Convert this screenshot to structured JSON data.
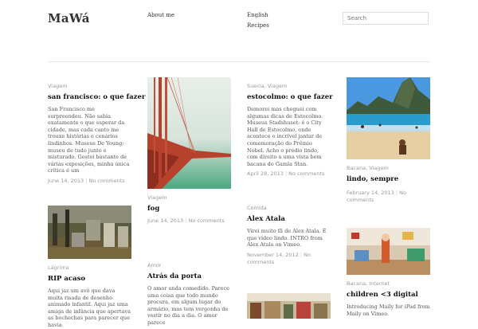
{
  "site": {
    "title": "MaWá"
  },
  "nav": {
    "about": "About me",
    "english": "English",
    "recipes": "Recipes"
  },
  "search": {
    "placeholder": "Search"
  },
  "posts": [
    {
      "category": "Viagem",
      "title": "san francisco: o que fazer",
      "excerpt": "San Francisco me surpreendeu. Não sabia exatamente o que esperar da cidade, mas cada canto me trouxe histórias e cenários lindinhos. Museus De Young: museu de tudo junto e misturado. Gostei bastante de várias exposições, minha única crítica é um",
      "date": "June 14, 2013",
      "comments": "No comments"
    },
    {
      "category": "Viagem",
      "title": "fog",
      "date": "June 14, 2013",
      "comments": "No comments"
    },
    {
      "category": "Suecia, Viagem",
      "title": "estocolmo: o que fazer",
      "excerpt": "Demorei mas cheguei com algumas dicas de Estocolmo. Museus Stadshuset: é o City Hall de Estocolmo, onde acontece o incrível jantar de comemoração do Prêmio Nobel. Acho o prédio lindo, com direito a uma vista bem bacana do Gamla Stan.",
      "date": "April 28, 2013",
      "comments": "No comments"
    },
    {
      "category": "Bacana, Viagem",
      "title": "lindo, sempre",
      "date": "February 14, 2013",
      "comments": "No comments"
    },
    {
      "category": "Lágrima",
      "title": "RIP acaso",
      "excerpt": "Aqui jaz um avô que dava muita risada de desenho animado infantil. Aqui jaz uma amiga de infância que apertava as bochechas para parecer que havia"
    },
    {
      "category": "Comida",
      "title": "Alex Atala",
      "excerpt": "Virei muito fã de Alex Atala. É que vídeo lindo. INTRO from Alex Atala on Vimeo.",
      "date": "November 14, 2012",
      "comments": "No comments"
    },
    {
      "category": "Amor",
      "title": "Atrás da porta",
      "excerpt": "O amor anda comedido. Parece uma coisa que todo mundo procura, em algum lugar do armário, mas tem vergonha de vestir no dia a dia. O amor parece"
    },
    {
      "category": "Bacana, Internet",
      "title": "children <3 digital",
      "excerpt": "Introducing Maily for iPad from Maily on Vimeo."
    }
  ],
  "colors": {
    "text": "#222222",
    "muted": "#999999",
    "divider": "#e6e6e6"
  }
}
